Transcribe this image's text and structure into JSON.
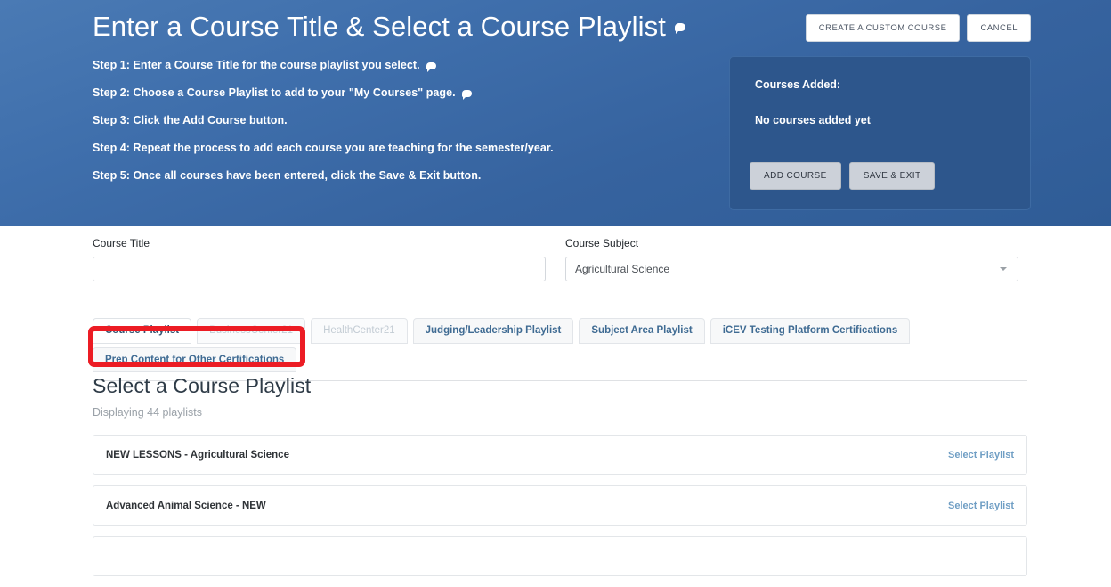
{
  "header": {
    "title": "Enter a Course Title & Select a Course Playlist",
    "title_icon": "speech-bubble-icon",
    "buttons": {
      "create_custom_course": "CREATE A CUSTOM COURSE",
      "cancel": "CANCEL"
    },
    "steps": [
      {
        "text": "Step 1: Enter a Course Title for the course playlist you select.",
        "has_tooltip": true
      },
      {
        "text": "Step 2: Choose a Course Playlist to add to your \"My Courses\" page.",
        "has_tooltip": true
      },
      {
        "text": "Step 3: Click the Add Course button.",
        "has_tooltip": false
      },
      {
        "text": "Step 4: Repeat the process to add each course you are teaching for the semester/year.",
        "has_tooltip": false
      },
      {
        "text": "Step 5: Once all courses have been entered, click the Save & Exit button.",
        "has_tooltip": false
      }
    ],
    "courses_panel": {
      "label": "Courses Added:",
      "empty_message": "No courses added yet",
      "add_course_button": "ADD COURSE",
      "save_exit_button": "SAVE & EXIT"
    },
    "gradient_from": "#4a7ab4",
    "gradient_to": "#2f5c96",
    "panel_color": "#2d568c"
  },
  "form": {
    "course_title": {
      "label": "Course Title",
      "value": "",
      "placeholder": ""
    },
    "course_subject": {
      "label": "Course Subject",
      "value": "Agricultural Science",
      "caret_icon": "chevron-down-icon"
    }
  },
  "tabs": [
    {
      "label": "Course Playlist",
      "state": "active"
    },
    {
      "label": "BusinessCenter21",
      "state": "muted"
    },
    {
      "label": "HealthCenter21",
      "state": "muted"
    },
    {
      "label": "Judging/Leadership Playlist",
      "state": "strong"
    },
    {
      "label": "Subject Area Playlist",
      "state": "strong"
    },
    {
      "label": "iCEV Testing Platform Certifications",
      "state": "strong"
    },
    {
      "label": "Prep Content for Other Certifications",
      "state": "strong"
    }
  ],
  "results": {
    "title": "Select a Course Playlist",
    "count_text": "Displaying 44 playlists",
    "select_link_label": "Select Playlist",
    "playlists": [
      {
        "name": "NEW LESSONS - Agricultural Science"
      },
      {
        "name": "Advanced Animal Science - NEW"
      },
      {
        "name": ""
      }
    ]
  },
  "annotation": {
    "color": "#ec1c24",
    "shape": "rounded-rectangle-highlight"
  }
}
